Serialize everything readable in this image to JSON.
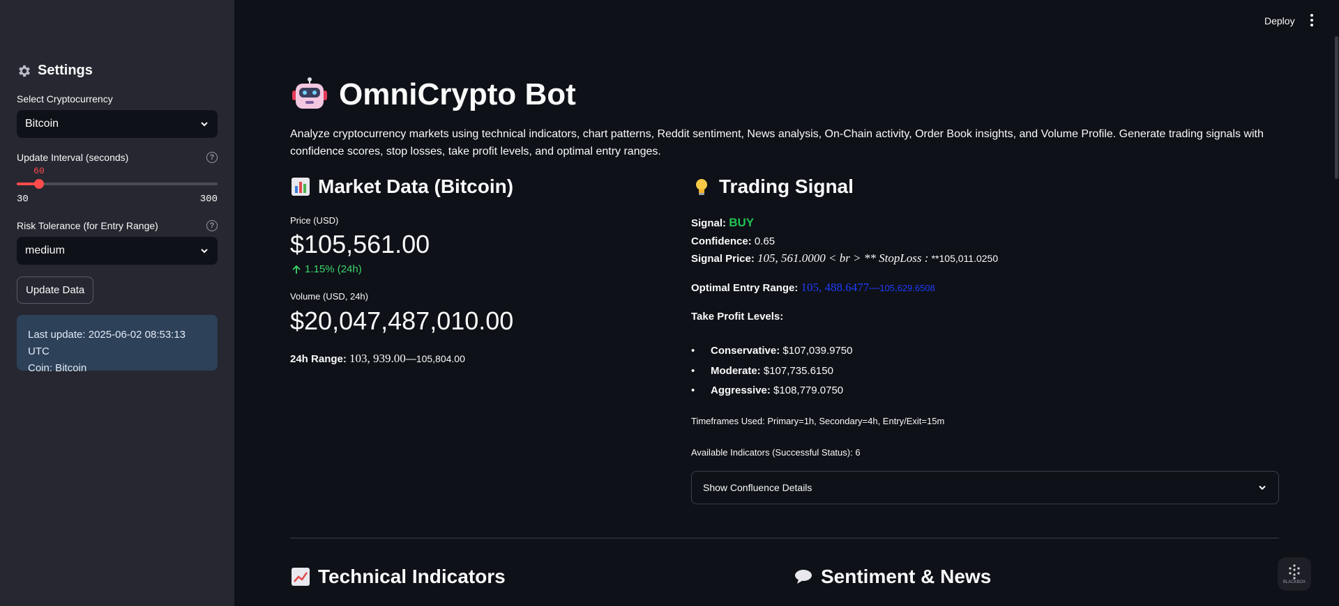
{
  "header": {
    "deploy_label": "Deploy"
  },
  "sidebar": {
    "title": "Settings",
    "crypto_label": "Select Cryptocurrency",
    "crypto_value": "Bitcoin",
    "interval_label": "Update Interval (seconds)",
    "interval_value": "60",
    "interval_min": "30",
    "interval_max": "300",
    "interval_fraction": 0.111,
    "risk_label": "Risk Tolerance (for Entry Range)",
    "risk_value": "medium",
    "help_glyph": "?",
    "update_button": "Update Data",
    "info_line1": "Last update: 2025-06-02 08:53:13 UTC",
    "info_line2": "Coin: Bitcoin"
  },
  "main": {
    "title": "OmniCrypto Bot",
    "intro": "Analyze cryptocurrency markets using technical indicators, chart patterns, Reddit sentiment, News analysis, On-Chain activity, Order Book insights, and Volume Profile. Generate trading signals with confidence scores, stop losses, take profit levels, and optimal entry ranges.",
    "market": {
      "heading": "Market Data (Bitcoin)",
      "price_label": "Price (USD)",
      "price_value": "$105,561.00",
      "price_delta": "1.15% (24h)",
      "volume_label": "Volume (USD, 24h)",
      "volume_value": "$20,047,487,010.00",
      "range_label": "24h Range:",
      "range_low": "103, 939.00",
      "range_sep": "—",
      "range_high": "105,804.00"
    },
    "signal": {
      "heading": "Trading Signal",
      "signal_label": "Signal:",
      "signal_value": "BUY",
      "confidence_label": "Confidence:",
      "confidence_value": "0.65",
      "price_label": "Signal Price:",
      "price_math": "105, 561.0000 < br > ** StopLoss :",
      "price_tail": "**105,011.0250",
      "entry_label": "Optimal Entry Range:",
      "entry_low": "105, 488.6477",
      "entry_sep": "—",
      "entry_high": "105,629.6508",
      "tp_heading": "Take Profit Levels:",
      "tp_levels": [
        {
          "label": "Conservative:",
          "value": "$107,039.9750"
        },
        {
          "label": "Moderate:",
          "value": "$107,735.6150"
        },
        {
          "label": "Aggressive:",
          "value": "$108,779.0750"
        }
      ],
      "timeframes": "Timeframes Used: Primary=1h, Secondary=4h, Entry/Exit=15m",
      "indicators": "Available Indicators (Successful Status): 6",
      "expander_label": "Show Confluence Details"
    },
    "technical_heading": "Technical Indicators",
    "sentiment_heading": "Sentiment & News"
  },
  "badge": {
    "label": "BLACKBOX"
  },
  "colors": {
    "accent": "#ff4b4b",
    "positive": "#21c354",
    "info_bg": "#2d4158",
    "sidebar_bg": "#262730",
    "page_bg": "#0e1117"
  }
}
